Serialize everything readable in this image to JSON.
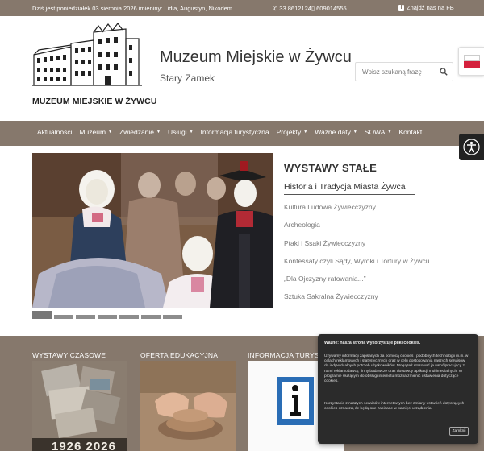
{
  "topbar": {
    "date_text": "Dziś jest poniedziałek 03 sierpnia 2026 imieniny: Lidia, Augustyn, Nikodem",
    "phone1": "33 8612124",
    "phone2": "609014555",
    "fb_text": "Znajdź nas na FB"
  },
  "header": {
    "logo_text": "MUZEUM MIEJSKIE W ŻYWCU",
    "title": "Muzeum Miejskie w Żywcu",
    "subtitle": "Stary Zamek",
    "search_placeholder": "Wpisz szukaną frazę"
  },
  "nav": {
    "items": [
      {
        "label": "Aktualności",
        "dropdown": false
      },
      {
        "label": "Muzeum",
        "dropdown": true
      },
      {
        "label": "Zwiedzanie",
        "dropdown": true
      },
      {
        "label": "Usługi",
        "dropdown": true
      },
      {
        "label": "Informacja turystyczna",
        "dropdown": false
      },
      {
        "label": "Projekty",
        "dropdown": true
      },
      {
        "label": "Ważne daty",
        "dropdown": true
      },
      {
        "label": "SOWA",
        "dropdown": true
      },
      {
        "label": "Kontakt",
        "dropdown": false
      }
    ]
  },
  "permanent": {
    "heading": "WYSTAWY STAŁE",
    "active_item": "Historia i Tradycja Miasta Żywca",
    "items": [
      "Kultura Ludowa Żywiecczyzny",
      "Archeologia",
      "Ptaki i Ssaki Żywiecczyzny",
      "Konfessaty czyli Sądy, Wyroki i Tortury w Żywcu",
      "„Dla Ojczyzny ratowania...”",
      "Sztuka Sakralna Żywiecczyzny"
    ]
  },
  "slider": {
    "slide_count": 7,
    "active_index": 0
  },
  "bottom": {
    "col1_title": "WYSTAWY CZASOWE",
    "col2_title": "OFERTA EDUKACYJNA",
    "col3_title": "INFORMACJA TURYSTY",
    "poster_years": "1926 2026"
  },
  "cookie": {
    "title": "Ważne: nasza strona wykorzystuje pliki cookies.",
    "paragraph1": "Używamy informacji zapisanych za pomocą cookies i podobnych technologii m.in. w celach reklamowych i statystycznych oraz w celu dostosowania naszych serwisów do indywidualnych potrzeb użytkowników. Mogą też stosować je współpracujący z nami reklamodawcy, firmy badawcze oraz dostawcy aplikacji multimedialnych. W programie służącym do obsługi internetu można zmienić ustawienia dotyczące cookies.",
    "paragraph2": "Korzystanie z naszych serwisów internetowych bez zmiany ustawień dotyczących cookies oznacza, że będą one zapisane w pamięci urządzenia.",
    "button": "Zamknij"
  },
  "colors": {
    "brand_brown": "#86786c",
    "cookie_bg": "#2b2b2b",
    "flag_red": "#d4213d"
  }
}
